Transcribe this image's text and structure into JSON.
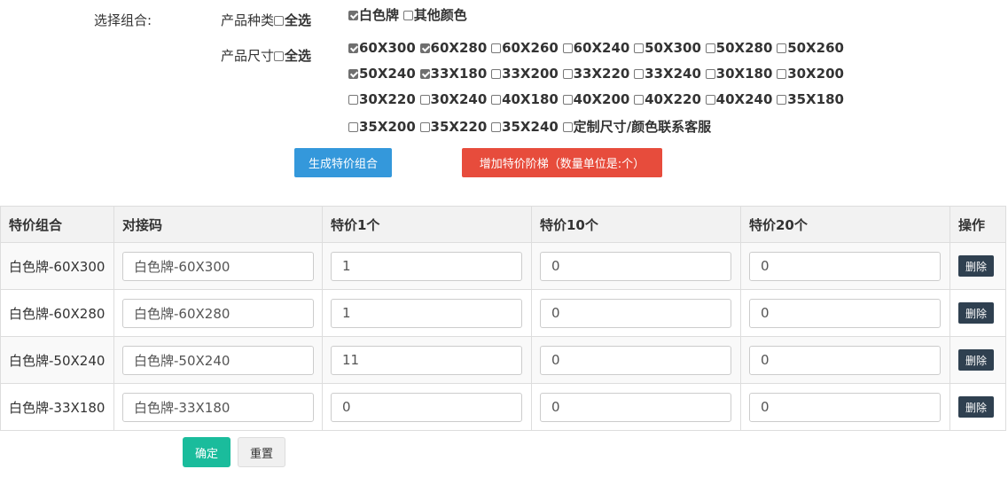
{
  "form": {
    "select_combo_label": "选择组合:",
    "type_label": "产品种类",
    "size_label": "产品尺寸",
    "select_all": "全选"
  },
  "types": [
    {
      "label": "白色牌",
      "checked": true
    },
    {
      "label": "其他颜色",
      "checked": false
    }
  ],
  "sizes": [
    [
      {
        "label": "60X300",
        "checked": true
      },
      {
        "label": "60X280",
        "checked": true
      },
      {
        "label": "60X260",
        "checked": false
      },
      {
        "label": "60X240",
        "checked": false
      },
      {
        "label": "50X300",
        "checked": false
      },
      {
        "label": "50X280",
        "checked": false
      },
      {
        "label": "50X260",
        "checked": false
      }
    ],
    [
      {
        "label": "50X240",
        "checked": true
      },
      {
        "label": "33X180",
        "checked": true
      },
      {
        "label": "33X200",
        "checked": false
      },
      {
        "label": "33X220",
        "checked": false
      },
      {
        "label": "33X240",
        "checked": false
      },
      {
        "label": "30X180",
        "checked": false
      },
      {
        "label": "30X200",
        "checked": false
      }
    ],
    [
      {
        "label": "30X220",
        "checked": false
      },
      {
        "label": "30X240",
        "checked": false
      },
      {
        "label": "40X180",
        "checked": false
      },
      {
        "label": "40X200",
        "checked": false
      },
      {
        "label": "40X220",
        "checked": false
      },
      {
        "label": "40X240",
        "checked": false
      },
      {
        "label": "35X180",
        "checked": false
      }
    ],
    [
      {
        "label": "35X200",
        "checked": false
      },
      {
        "label": "35X220",
        "checked": false
      },
      {
        "label": "35X240",
        "checked": false
      },
      {
        "label": "定制尺寸/颜色联系客服",
        "checked": false
      }
    ]
  ],
  "buttons": {
    "generate": "生成特价组合",
    "add_tier": "增加特价阶梯（数量单位是:个）",
    "confirm": "确定",
    "reset": "重置",
    "delete": "删除"
  },
  "table": {
    "headers": [
      "特价组合",
      "对接码",
      "特价1个",
      "特价10个",
      "特价20个",
      "操作"
    ],
    "rows": [
      {
        "combo": "白色牌-60X300",
        "code": "白色牌-60X300",
        "p1": "1",
        "p10": "0",
        "p20": "0"
      },
      {
        "combo": "白色牌-60X280",
        "code": "白色牌-60X280",
        "p1": "1",
        "p10": "0",
        "p20": "0"
      },
      {
        "combo": "白色牌-50X240",
        "code": "白色牌-50X240",
        "p1": "11",
        "p10": "0",
        "p20": "0"
      },
      {
        "combo": "白色牌-33X180",
        "code": "白色牌-33X180",
        "p1": "0",
        "p10": "0",
        "p20": "0"
      }
    ]
  },
  "colors": {
    "generate_button": "#3498db",
    "add_tier_button": "#e74c3c",
    "confirm_button": "#1abc9c",
    "delete_button": "#2f4050"
  }
}
